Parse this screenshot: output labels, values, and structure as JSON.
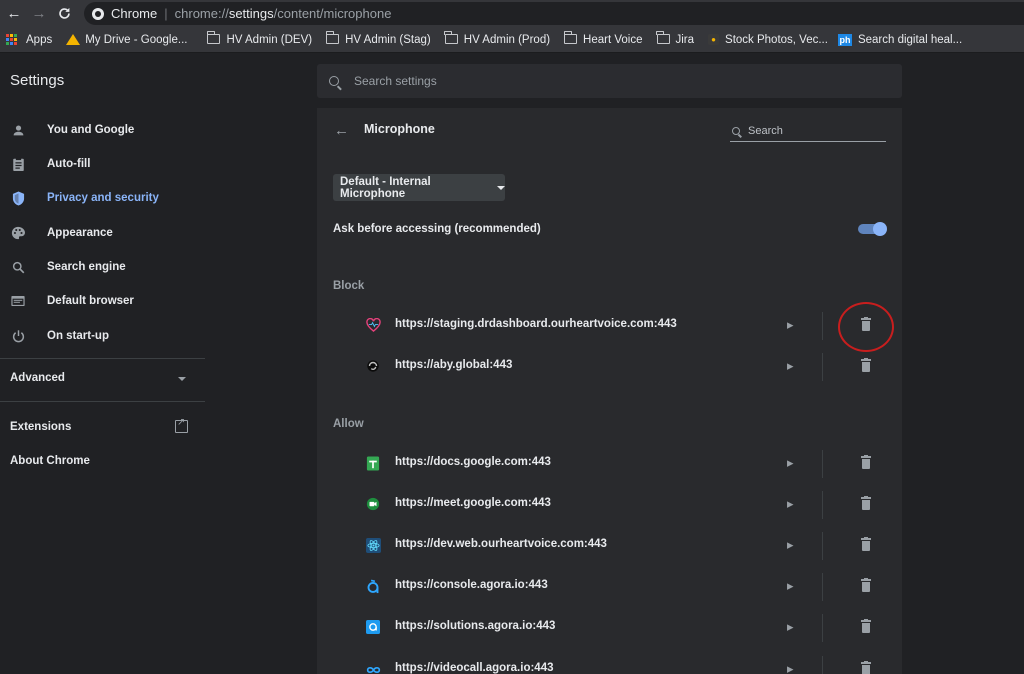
{
  "browser": {
    "nav": {
      "back": "←",
      "forward": "→",
      "reload": "C"
    },
    "omnibox": {
      "app": "Chrome",
      "url_pre": "chrome://",
      "url_host": "settings",
      "url_post": "/content/microphone"
    }
  },
  "bookmarks": [
    {
      "label": "Apps",
      "icon": "apps-icon"
    },
    {
      "label": "My Drive - Google...",
      "icon": "drive-icon"
    },
    {
      "label": "HV Admin (DEV)",
      "icon": "folder-icon"
    },
    {
      "label": "HV Admin (Stag)",
      "icon": "folder-icon"
    },
    {
      "label": "HV Admin (Prod)",
      "icon": "folder-icon"
    },
    {
      "label": "Heart Voice",
      "icon": "folder-icon"
    },
    {
      "label": "Jira",
      "icon": "folder-icon"
    },
    {
      "label": "Stock Photos, Vec...",
      "icon": "stock-icon"
    },
    {
      "label": "Search digital heal...",
      "icon": "ph-icon"
    }
  ],
  "header": {
    "title": "Settings",
    "search_placeholder": "Search settings"
  },
  "sidebar": {
    "items": [
      {
        "label": "You and Google",
        "icon": "person-icon"
      },
      {
        "label": "Auto-fill",
        "icon": "clipboard-icon"
      },
      {
        "label": "Privacy and security",
        "icon": "shield-icon"
      },
      {
        "label": "Appearance",
        "icon": "palette-icon"
      },
      {
        "label": "Search engine",
        "icon": "search-icon"
      },
      {
        "label": "Default browser",
        "icon": "browser-icon"
      },
      {
        "label": "On start-up",
        "icon": "power-icon"
      }
    ],
    "advanced": "Advanced",
    "extensions": "Extensions",
    "about": "About Chrome"
  },
  "main": {
    "title": "Microphone",
    "search_placeholder": "Search",
    "device_select": "Default - Internal Microphone",
    "ask_label": "Ask before accessing (recommended)",
    "ask_enabled": true,
    "block_label": "Block",
    "allow_label": "Allow",
    "block_sites": [
      {
        "url": "https://staging.drdashboard.ourheartvoice.com:443",
        "icon": "heart-icon"
      },
      {
        "url": "https://aby.global:443",
        "icon": "aby-icon"
      }
    ],
    "allow_sites": [
      {
        "url": "https://docs.google.com:443",
        "icon": "sheets-icon"
      },
      {
        "url": "https://meet.google.com:443",
        "icon": "meet-icon"
      },
      {
        "url": "https://dev.web.ourheartvoice.com:443",
        "icon": "react-icon"
      },
      {
        "url": "https://console.agora.io:443",
        "icon": "agora-icon"
      },
      {
        "url": "https://solutions.agora.io:443",
        "icon": "agora-solutions-icon"
      },
      {
        "url": "https://videocall.agora.io:443",
        "icon": "infinity-icon"
      }
    ]
  },
  "colors": {
    "accent": "#8ab4f8",
    "annotation": "#c81e1e"
  }
}
